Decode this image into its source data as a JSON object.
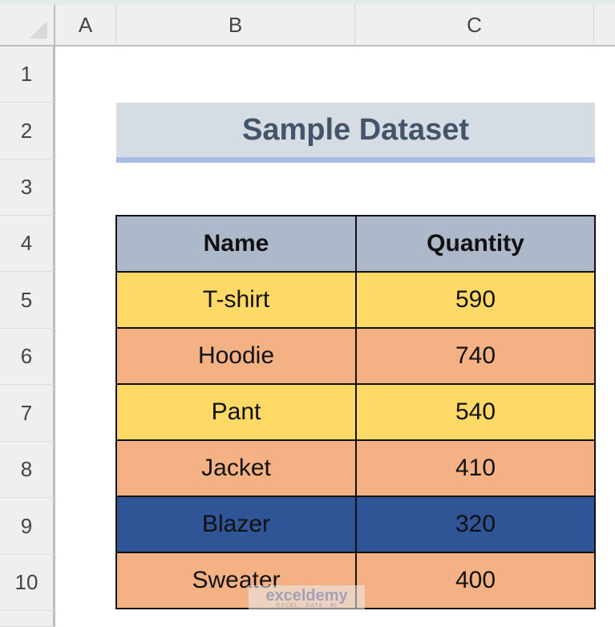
{
  "spreadsheet": {
    "columns": [
      "A",
      "B",
      "C"
    ],
    "rows": [
      "1",
      "2",
      "3",
      "4",
      "5",
      "6",
      "7",
      "8",
      "9",
      "10"
    ],
    "title": "Sample Dataset",
    "table": {
      "headers": [
        "Name",
        "Quantity"
      ],
      "rows": [
        {
          "name": "T-shirt",
          "quantity": "590",
          "color": "#ffd966"
        },
        {
          "name": "Hoodie",
          "quantity": "740",
          "color": "#f4b183"
        },
        {
          "name": "Pant",
          "quantity": "540",
          "color": "#ffd966"
        },
        {
          "name": "Jacket",
          "quantity": "410",
          "color": "#f4b183"
        },
        {
          "name": "Blazer",
          "quantity": "320",
          "color": "#2f5597"
        },
        {
          "name": "Sweater",
          "quantity": "400",
          "color": "#f4b183"
        }
      ],
      "header_color": "#adb9ca"
    },
    "watermark": {
      "logo": "exceldemy",
      "tagline": "EXCEL · DATA · BI"
    }
  }
}
